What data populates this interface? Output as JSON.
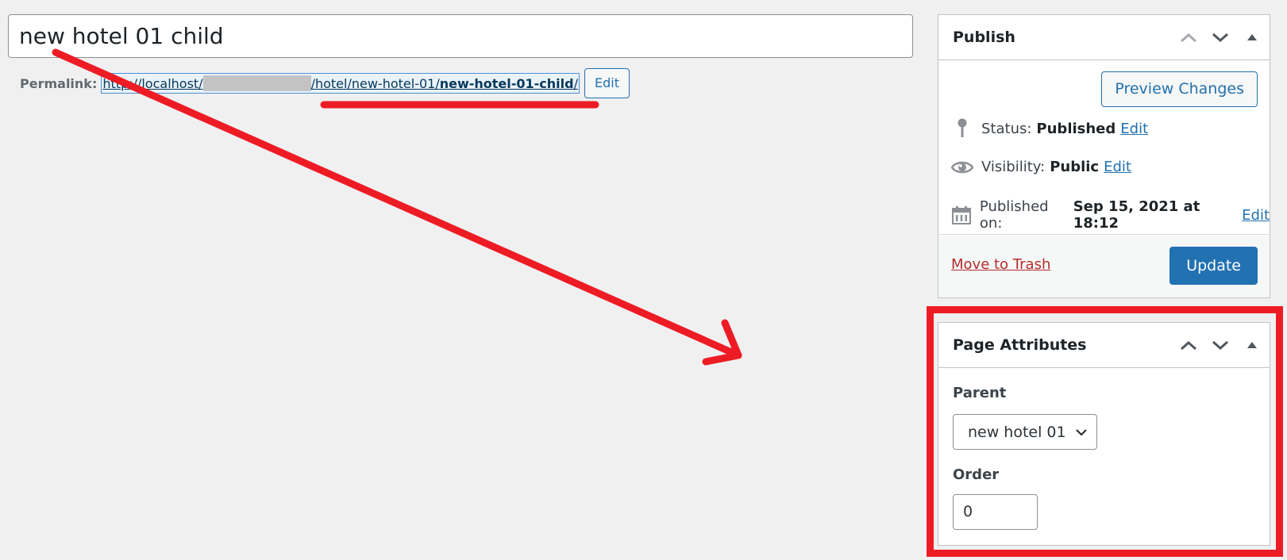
{
  "editor": {
    "title_value": "new hotel 01 child",
    "permalink": {
      "label": "Permalink:",
      "url_prefix": "http://localhost/",
      "url_path": "/hotel/new-hotel-01/",
      "slug": "new-hotel-01-child",
      "trailing_slash": "/",
      "edit_label": "Edit"
    }
  },
  "publish_box": {
    "title": "Publish",
    "preview_label": "Preview Changes",
    "status": {
      "label": "Status:",
      "value": "Published",
      "edit": "Edit"
    },
    "visibility": {
      "label": "Visibility:",
      "value": "Public",
      "edit": "Edit"
    },
    "published_on": {
      "label": "Published on:",
      "value": "Sep 15, 2021 at 18:12",
      "edit": "Edit"
    },
    "trash_label": "Move to Trash",
    "update_label": "Update"
  },
  "page_attributes": {
    "title": "Page Attributes",
    "parent_label": "Parent",
    "parent_value": "new hotel 01",
    "order_label": "Order",
    "order_value": "0"
  },
  "annotations": {
    "color": "#ed1c24",
    "items": [
      "arrow from permalink to page attributes",
      "underline under permalink path",
      "highlight box around page attributes"
    ]
  }
}
